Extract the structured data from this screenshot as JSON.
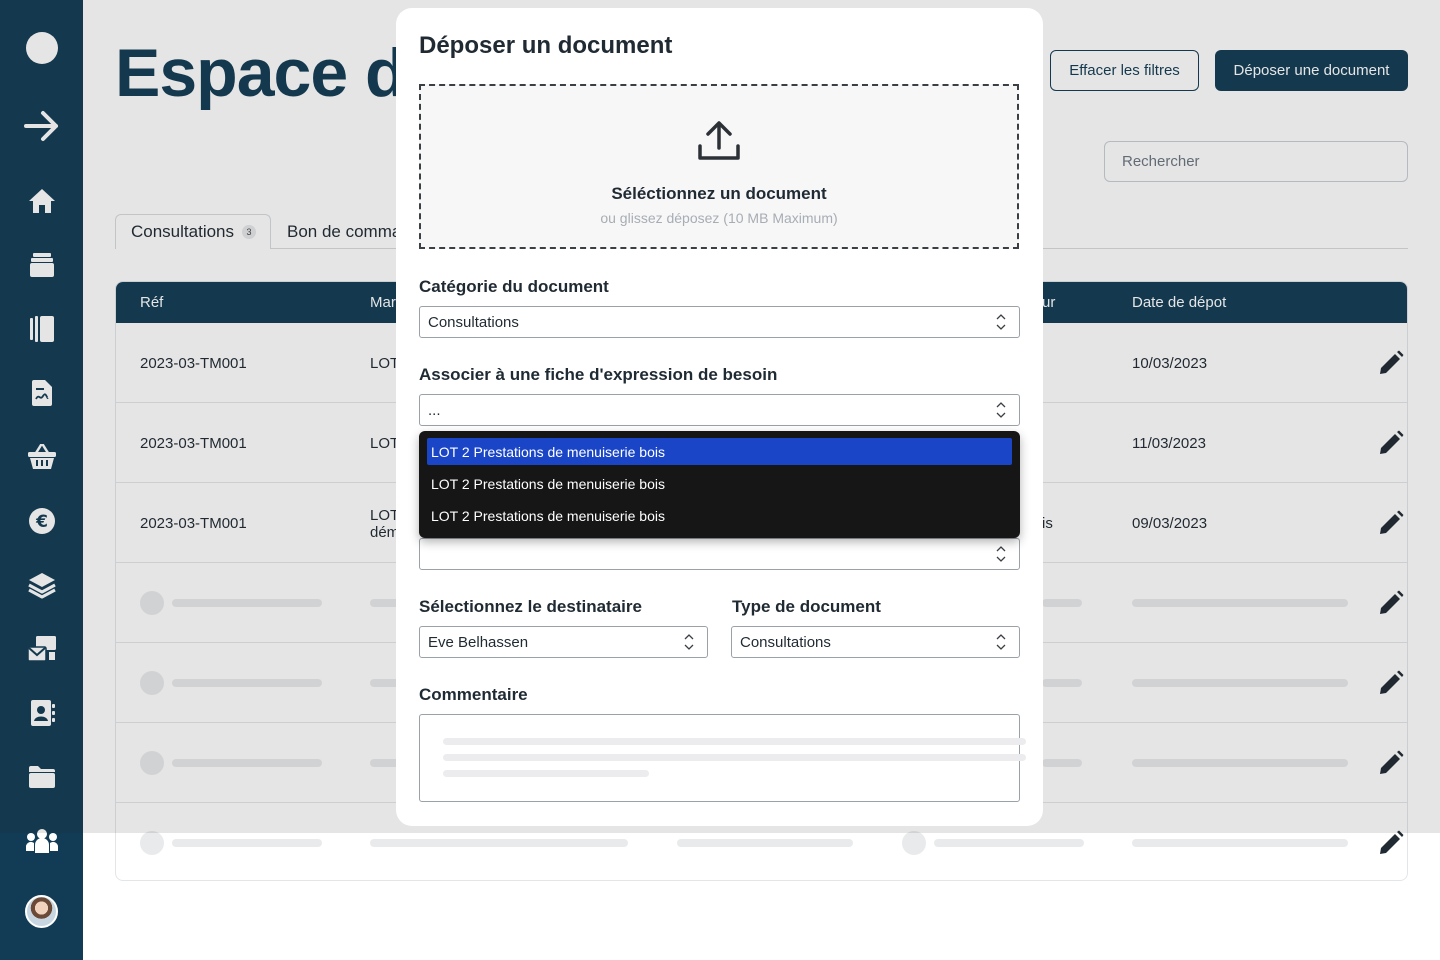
{
  "page": {
    "title": "Espace d",
    "clear_filters_label": "Effacer les filtres",
    "upload_button_label": "Déposer une document",
    "search_placeholder": "Rechercher"
  },
  "tabs": [
    {
      "label": "Consultations",
      "badge": "3"
    },
    {
      "label": "Bon de comma"
    }
  ],
  "table": {
    "headers": [
      "Réf",
      "Mar",
      "ur",
      "Date de dépot"
    ],
    "rows": [
      {
        "ref": "2023-03-TM001",
        "marche": "LOT",
        "marche2": "",
        "extra": "",
        "date": "10/03/2023"
      },
      {
        "ref": "2023-03-TM001",
        "marche": "LOT",
        "marche2": "",
        "extra": "",
        "date": "11/03/2023"
      },
      {
        "ref": "2023-03-TM001",
        "marche": "LOT",
        "marche2": "dém",
        "extra": "is",
        "date": "09/03/2023"
      }
    ]
  },
  "modal": {
    "title": "Déposer un document",
    "dropzone_title": "Séléctionnez un document",
    "dropzone_sub": "ou glissez déposez (10 MB Maximum)",
    "category_label": "Catégorie du document",
    "category_value": "Consultations",
    "associate_label": "Associer à une fiche d'expression de besoin",
    "associate_value": "...",
    "dropdown_options": [
      "LOT 2 Prestations de menuiserie bois",
      "LOT 2 Prestations de menuiserie bois",
      "LOT 2 Prestations de menuiserie bois"
    ],
    "recipient_label": "Sélectionnez le destinataire",
    "recipient_value": "Eve Belhassen",
    "doctype_label": "Type de document",
    "doctype_value": "Consultations",
    "comment_label": "Commentaire"
  },
  "sidebar": {
    "icons": [
      "circle-icon",
      "arrow-right-icon",
      "home-icon",
      "archive-icon",
      "book-icon",
      "file-signature-icon",
      "basket-icon",
      "euro-icon",
      "layers-icon",
      "mail-bulk-icon",
      "contact-book-icon",
      "folder-icon",
      "users-icon"
    ]
  }
}
